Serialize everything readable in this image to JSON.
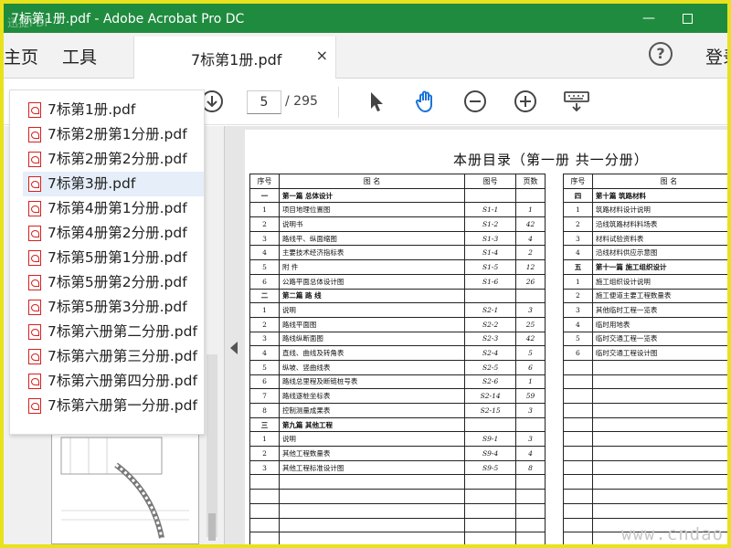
{
  "window": {
    "title": "7标第1册.pdf - Adobe Acrobat Pro DC",
    "watermark": "迅捷PDF",
    "minimize_label": "—",
    "colors": {
      "titlebar": "#1f8b3f",
      "frame": "#e8e21c"
    }
  },
  "menu": {
    "home": "主页",
    "tools": "工具",
    "doc_tab": "7标第1册.pdf",
    "close_tab": "×",
    "help": "?",
    "login": "登录"
  },
  "toolbar": {
    "current_page": "5",
    "total_pages": "/ 295",
    "icons": [
      "page-down-icon",
      "select-cursor-icon",
      "hand-tool-icon",
      "zoom-out-icon",
      "zoom-in-icon",
      "keyboard-icon"
    ]
  },
  "file_list": [
    "7标第1册.pdf",
    "7标第2册第1分册.pdf",
    "7标第2册第2分册.pdf",
    "7标第3册.pdf",
    "7标第4册第1分册.pdf",
    "7标第4册第2分册.pdf",
    "7标第5册第1分册.pdf",
    "7标第5册第2分册.pdf",
    "7标第5册第3分册.pdf",
    "7标第六册第二分册.pdf",
    "7标第六册第三分册.pdf",
    "7标第六册第四分册.pdf",
    "7标第六册第一分册.pdf"
  ],
  "file_list_selected": 3,
  "document": {
    "title": "本册目录（第一册  共一分册）",
    "left_headers": [
      "序号",
      "图    名",
      "图号",
      "页数"
    ],
    "left_rows": [
      {
        "no": "一",
        "name": "第一篇   总体设计",
        "code": "",
        "pages": "",
        "section": true
      },
      {
        "no": "1",
        "name": "项目地理位置图",
        "code": "S1-1",
        "pages": "1"
      },
      {
        "no": "2",
        "name": "说明书",
        "code": "S1-2",
        "pages": "42"
      },
      {
        "no": "3",
        "name": "路线平、纵面缩图",
        "code": "S1-3",
        "pages": "4"
      },
      {
        "no": "4",
        "name": "主要技术经济指标表",
        "code": "S1-4",
        "pages": "2"
      },
      {
        "no": "5",
        "name": "附    件",
        "code": "S1-5",
        "pages": "12"
      },
      {
        "no": "6",
        "name": "公路平面总体设计图",
        "code": "S1-6",
        "pages": "26"
      },
      {
        "no": "二",
        "name": "第二篇   路      线",
        "code": "",
        "pages": "",
        "section": true
      },
      {
        "no": "1",
        "name": "说明",
        "code": "S2-1",
        "pages": "3"
      },
      {
        "no": "2",
        "name": "路线平面图",
        "code": "S2-2",
        "pages": "25"
      },
      {
        "no": "3",
        "name": "路线纵断面图",
        "code": "S2-3",
        "pages": "42"
      },
      {
        "no": "4",
        "name": "直线、曲线及转角表",
        "code": "S2-4",
        "pages": "5"
      },
      {
        "no": "5",
        "name": "纵坡、竖曲线表",
        "code": "S2-5",
        "pages": "6"
      },
      {
        "no": "6",
        "name": "路线总里程及断链桩号表",
        "code": "S2-6",
        "pages": "1"
      },
      {
        "no": "7",
        "name": "路线逐桩坐标表",
        "code": "S2-14",
        "pages": "59"
      },
      {
        "no": "8",
        "name": "控制测量成果表",
        "code": "S2-15",
        "pages": "3"
      },
      {
        "no": "三",
        "name": "第九篇   其他工程",
        "code": "",
        "pages": "",
        "section": true
      },
      {
        "no": "1",
        "name": "说明",
        "code": "S9-1",
        "pages": "3"
      },
      {
        "no": "2",
        "name": "其他工程数量表",
        "code": "S9-4",
        "pages": "4"
      },
      {
        "no": "3",
        "name": "其他工程标准设计图",
        "code": "S9-5",
        "pages": "8"
      },
      {
        "no": "",
        "name": "",
        "code": "",
        "pages": ""
      },
      {
        "no": "",
        "name": "",
        "code": "",
        "pages": ""
      },
      {
        "no": "",
        "name": "",
        "code": "",
        "pages": ""
      },
      {
        "no": "",
        "name": "",
        "code": "",
        "pages": ""
      },
      {
        "no": "",
        "name": "",
        "code": "",
        "pages": ""
      }
    ],
    "right_headers": [
      "序号",
      "图    名"
    ],
    "right_rows": [
      {
        "no": "四",
        "name": "第十篇   筑路材料",
        "section": true
      },
      {
        "no": "1",
        "name": "筑路材料设计说明"
      },
      {
        "no": "2",
        "name": "沿线筑路材料料场表"
      },
      {
        "no": "3",
        "name": "材料试验资料表"
      },
      {
        "no": "4",
        "name": "沿线材料供应示意图"
      },
      {
        "no": "五",
        "name": "第十一篇   施工组织设计",
        "section": true
      },
      {
        "no": "1",
        "name": "施工组织设计说明"
      },
      {
        "no": "2",
        "name": "施工便道主要工程数量表"
      },
      {
        "no": "3",
        "name": "其他临时工程一览表"
      },
      {
        "no": "4",
        "name": "临时用地表"
      },
      {
        "no": "5",
        "name": "临时交通工程一览表"
      },
      {
        "no": "6",
        "name": "临时交通工程设计图"
      },
      {
        "no": "",
        "name": ""
      },
      {
        "no": "",
        "name": ""
      },
      {
        "no": "",
        "name": ""
      },
      {
        "no": "",
        "name": ""
      },
      {
        "no": "",
        "name": ""
      },
      {
        "no": "",
        "name": ""
      },
      {
        "no": "",
        "name": ""
      },
      {
        "no": "",
        "name": ""
      },
      {
        "no": "",
        "name": ""
      },
      {
        "no": "",
        "name": ""
      },
      {
        "no": "",
        "name": ""
      },
      {
        "no": "",
        "name": ""
      },
      {
        "no": "",
        "name": ""
      }
    ],
    "watermark": "www.cndao.com"
  }
}
